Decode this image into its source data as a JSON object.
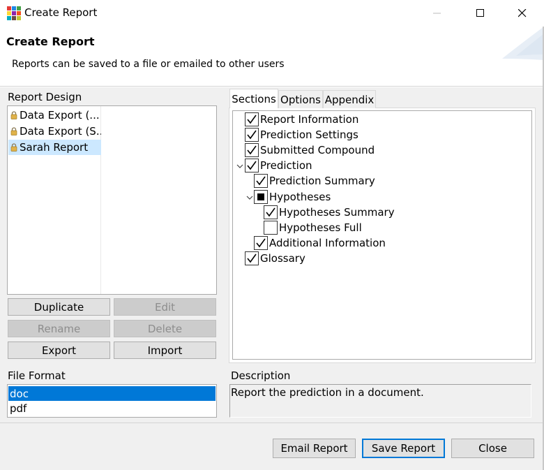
{
  "window": {
    "title": "Create Report",
    "icon": "app-grid-icon",
    "controls": [
      "minimize-icon",
      "maximize-icon",
      "close-icon"
    ]
  },
  "header": {
    "title": "Create Report",
    "subtitle": "Reports can be saved to a file or emailed to other users"
  },
  "report_design": {
    "label": "Report Design",
    "items": [
      {
        "label": "Data Export (...",
        "icon": "lock-icon",
        "selected": false
      },
      {
        "label": "Data Export (S...",
        "icon": "lock-icon",
        "selected": false
      },
      {
        "label": "Sarah Report",
        "icon": "lock-icon",
        "selected": true
      }
    ],
    "buttons": {
      "duplicate": "Duplicate",
      "edit": "Edit",
      "rename": "Rename",
      "delete": "Delete",
      "export": "Export",
      "import": "Import"
    }
  },
  "tabs": [
    {
      "label": "Sections",
      "active": true
    },
    {
      "label": "Options",
      "active": false
    },
    {
      "label": "Appendix",
      "active": false
    }
  ],
  "sections_tree": [
    {
      "label": "Report Information",
      "state": "checked",
      "level": 0
    },
    {
      "label": "Prediction Settings",
      "state": "checked",
      "level": 0
    },
    {
      "label": "Submitted Compound",
      "state": "checked",
      "level": 0
    },
    {
      "label": "Prediction",
      "state": "checked",
      "level": 0,
      "expanded": true
    },
    {
      "label": "Prediction Summary",
      "state": "checked",
      "level": 1
    },
    {
      "label": "Hypotheses",
      "state": "partial",
      "level": 1,
      "expanded": true
    },
    {
      "label": "Hypotheses Summary",
      "state": "checked",
      "level": 2
    },
    {
      "label": "Hypotheses Full",
      "state": "unchecked",
      "level": 2
    },
    {
      "label": "Additional Information",
      "state": "checked",
      "level": 1
    },
    {
      "label": "Glossary",
      "state": "checked",
      "level": 0
    }
  ],
  "file_format": {
    "label": "File Format",
    "options": [
      "doc",
      "pdf"
    ],
    "selected": "doc"
  },
  "description": {
    "label": "Description",
    "text": "Report the prediction in a document."
  },
  "footer_buttons": {
    "email": "Email Report",
    "save": "Save Report",
    "close": "Close"
  },
  "colors": {
    "selection_light": "#cce8ff",
    "selection_dark": "#0078d7",
    "dialog_bg": "#f0f0f0"
  }
}
